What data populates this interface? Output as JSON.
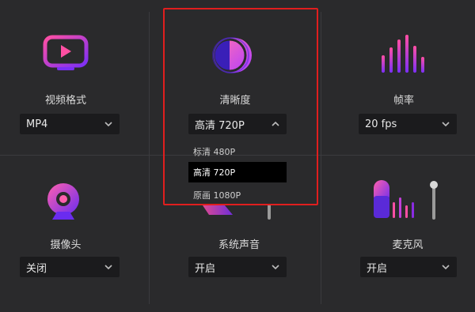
{
  "cells": {
    "video_format": {
      "label": "视频格式",
      "value": "MP4"
    },
    "clarity": {
      "label": "清晰度",
      "value": "高清 720P"
    },
    "frame_rate": {
      "label": "帧率",
      "value": "20 fps"
    },
    "camera": {
      "label": "摄像头",
      "value": "关闭"
    },
    "system_audio": {
      "label": "系统声音",
      "value": "开启"
    },
    "microphone": {
      "label": "麦克风",
      "value": "开启"
    }
  },
  "clarity_dropdown": {
    "options": [
      "标清 480P",
      "高清 720P",
      "原画 1080P"
    ],
    "selected_index": 1
  },
  "colors": {
    "background": "#2a2a2c",
    "select_bg": "#1b1b1d",
    "highlight": "#e01e1e",
    "accent_purple": "#8a2be2",
    "accent_pink": "#ff4fa3"
  },
  "icons": {
    "video_format": "play-video-icon",
    "clarity": "clarity-icon",
    "frame_rate": "frame-rate-bars-icon",
    "camera": "webcam-icon",
    "system_audio": "speaker-icon",
    "microphone": "microphone-icon"
  }
}
